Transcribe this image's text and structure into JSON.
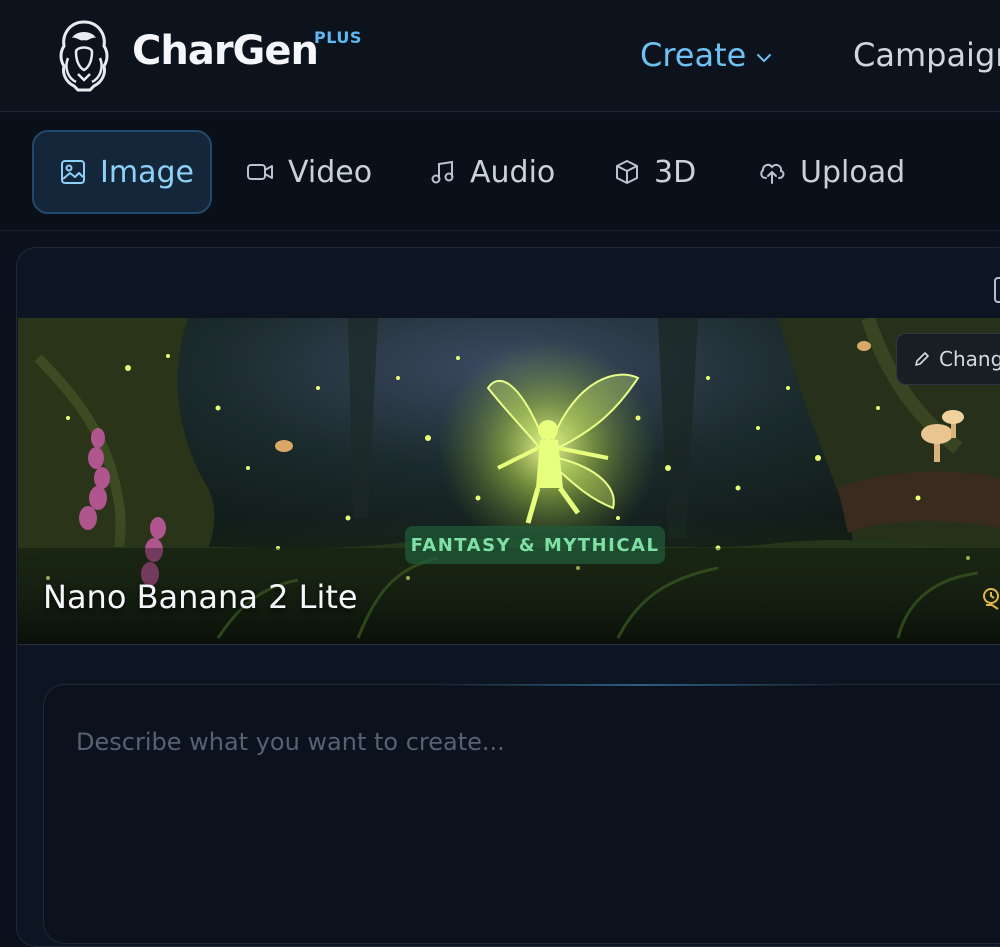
{
  "header": {
    "brand": "CharGen",
    "brand_badge": "PLUS",
    "nav": [
      {
        "label": "Create",
        "active": true,
        "dropdown": true
      },
      {
        "label": "Campaign"
      }
    ]
  },
  "media_tabs": [
    {
      "label": "Image",
      "icon": "image-icon",
      "active": true
    },
    {
      "label": "Video",
      "icon": "video-icon"
    },
    {
      "label": "Audio",
      "icon": "music-note-icon"
    },
    {
      "label": "3D",
      "icon": "cube-icon"
    },
    {
      "label": "Upload",
      "icon": "cloud-upload-icon"
    }
  ],
  "model_card": {
    "change_button": "Chang",
    "category": "FANTASY & MYTHICAL",
    "model_name": "Nano Banana 2 Lite"
  },
  "prompt": {
    "placeholder": "Describe what you want to create..."
  },
  "colors": {
    "accent": "#6fc0f4",
    "background": "#0b111c",
    "badge_text": "#7fe0a6",
    "badge_bg": "#205c3a"
  }
}
